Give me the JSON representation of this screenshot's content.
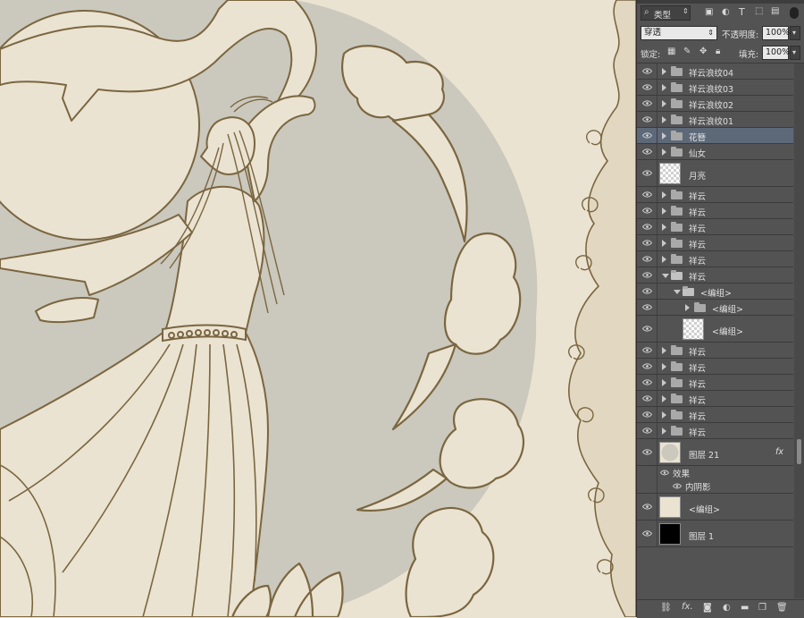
{
  "canvas": {
    "bg_color": "#ebe3d1",
    "moon_circle_color": "#cbc8bd",
    "line_color": "#7a6640"
  },
  "panel": {
    "filter": {
      "kind_label": "类型",
      "search_icon": "search-icon"
    },
    "blend_mode": "穿透",
    "opacity_label": "不透明度:",
    "opacity_value": "100%",
    "lock_label": "锁定:",
    "fill_label": "填充:",
    "fill_value": "100%",
    "effects_label": "效果",
    "inner_shadow_label": "内阴影",
    "fx_badge": "fx",
    "layers": [
      {
        "name": "祥云浪纹04",
        "type": "group",
        "expanded": false,
        "indent": 0
      },
      {
        "name": "祥云浪纹03",
        "type": "group",
        "expanded": false,
        "indent": 0
      },
      {
        "name": "祥云浪纹02",
        "type": "group",
        "expanded": false,
        "indent": 0
      },
      {
        "name": "祥云浪纹01",
        "type": "group",
        "expanded": false,
        "indent": 0
      },
      {
        "name": "花簪",
        "type": "group",
        "expanded": false,
        "indent": 0,
        "selected": true
      },
      {
        "name": "仙女",
        "type": "group",
        "expanded": false,
        "indent": 0
      },
      {
        "name": "月亮",
        "type": "layer",
        "thumb": "checker",
        "indent": 0
      },
      {
        "name": "祥云",
        "type": "group",
        "expanded": false,
        "indent": 0
      },
      {
        "name": "祥云",
        "type": "group",
        "expanded": false,
        "indent": 0
      },
      {
        "name": "祥云",
        "type": "group",
        "expanded": false,
        "indent": 0
      },
      {
        "name": "祥云",
        "type": "group",
        "expanded": false,
        "indent": 0
      },
      {
        "name": "祥云",
        "type": "group",
        "expanded": false,
        "indent": 0
      },
      {
        "name": "祥云",
        "type": "group",
        "expanded": true,
        "indent": 0
      },
      {
        "name": "<编组>",
        "type": "group",
        "expanded": true,
        "indent": 1
      },
      {
        "name": "<编组>",
        "type": "group",
        "expanded": false,
        "indent": 2
      },
      {
        "name": "<编组>",
        "type": "layer",
        "thumb": "checker",
        "indent": 2
      },
      {
        "name": "祥云",
        "type": "group",
        "expanded": false,
        "indent": 0
      },
      {
        "name": "祥云",
        "type": "group",
        "expanded": false,
        "indent": 0
      },
      {
        "name": "祥云",
        "type": "group",
        "expanded": false,
        "indent": 0
      },
      {
        "name": "祥云",
        "type": "group",
        "expanded": false,
        "indent": 0
      },
      {
        "name": "祥云",
        "type": "group",
        "expanded": false,
        "indent": 0
      },
      {
        "name": "祥云",
        "type": "group",
        "expanded": false,
        "indent": 0
      },
      {
        "name": "图层 21",
        "type": "layer",
        "thumb": "grey-circle",
        "indent": 0,
        "fx": true
      },
      {
        "name": "<编组>",
        "type": "layer",
        "thumb": "beige",
        "indent": 0
      },
      {
        "name": "图层 1",
        "type": "layer",
        "thumb": "black",
        "indent": 0
      }
    ],
    "bottom_icons": [
      "link-icon",
      "fx-icon",
      "mask-icon",
      "adjustment-icon",
      "new-group-icon",
      "new-layer-icon",
      "trash-icon"
    ]
  }
}
